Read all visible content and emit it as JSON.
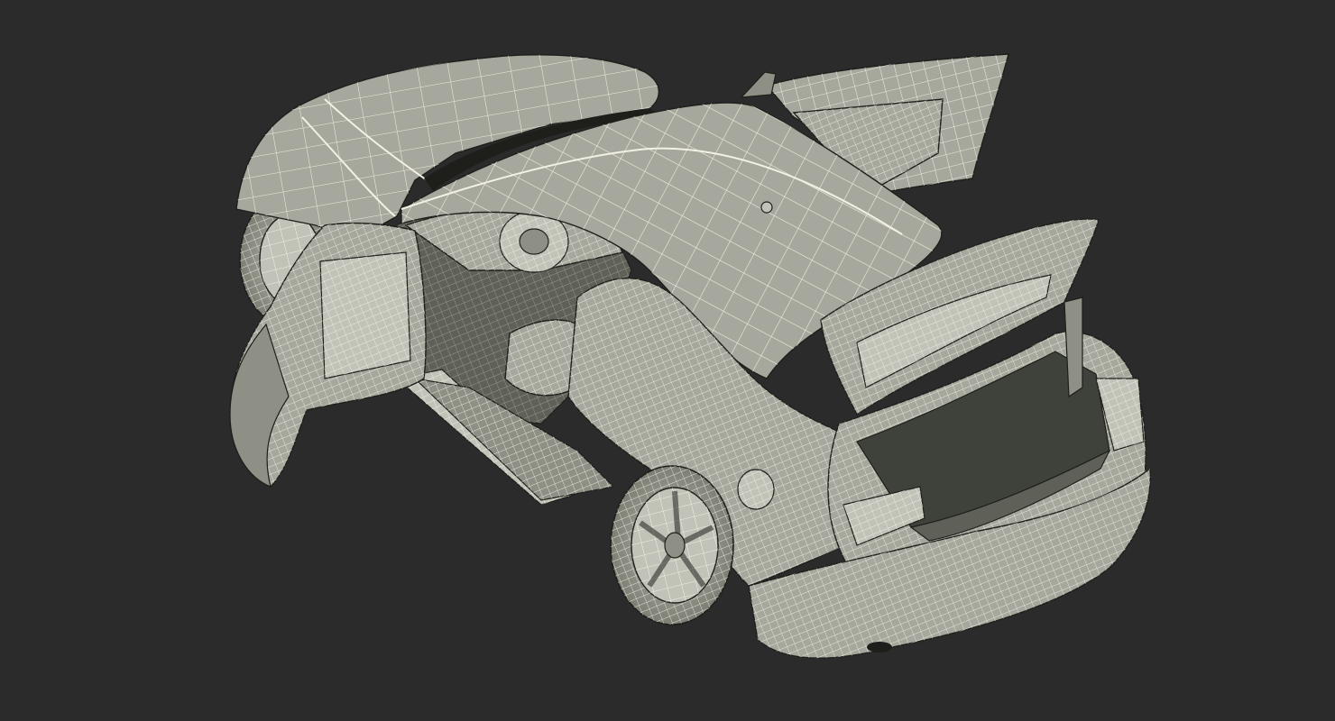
{
  "viewport": {
    "background_color": "#2b2b2b",
    "render_mode": "wireframe",
    "subject": "car-3d-model",
    "doors_open": true,
    "trunk_open": true
  },
  "colors": {
    "mesh_fill": "#a7a89d",
    "mesh_fill_dark": "#8e9085",
    "mesh_fill_light": "#c2c3b8",
    "interior_fill": "#5f6158",
    "interior_dark": "#3f413b",
    "wire_color": "#f2f1e4",
    "outline_color": "#1e1f1b"
  }
}
